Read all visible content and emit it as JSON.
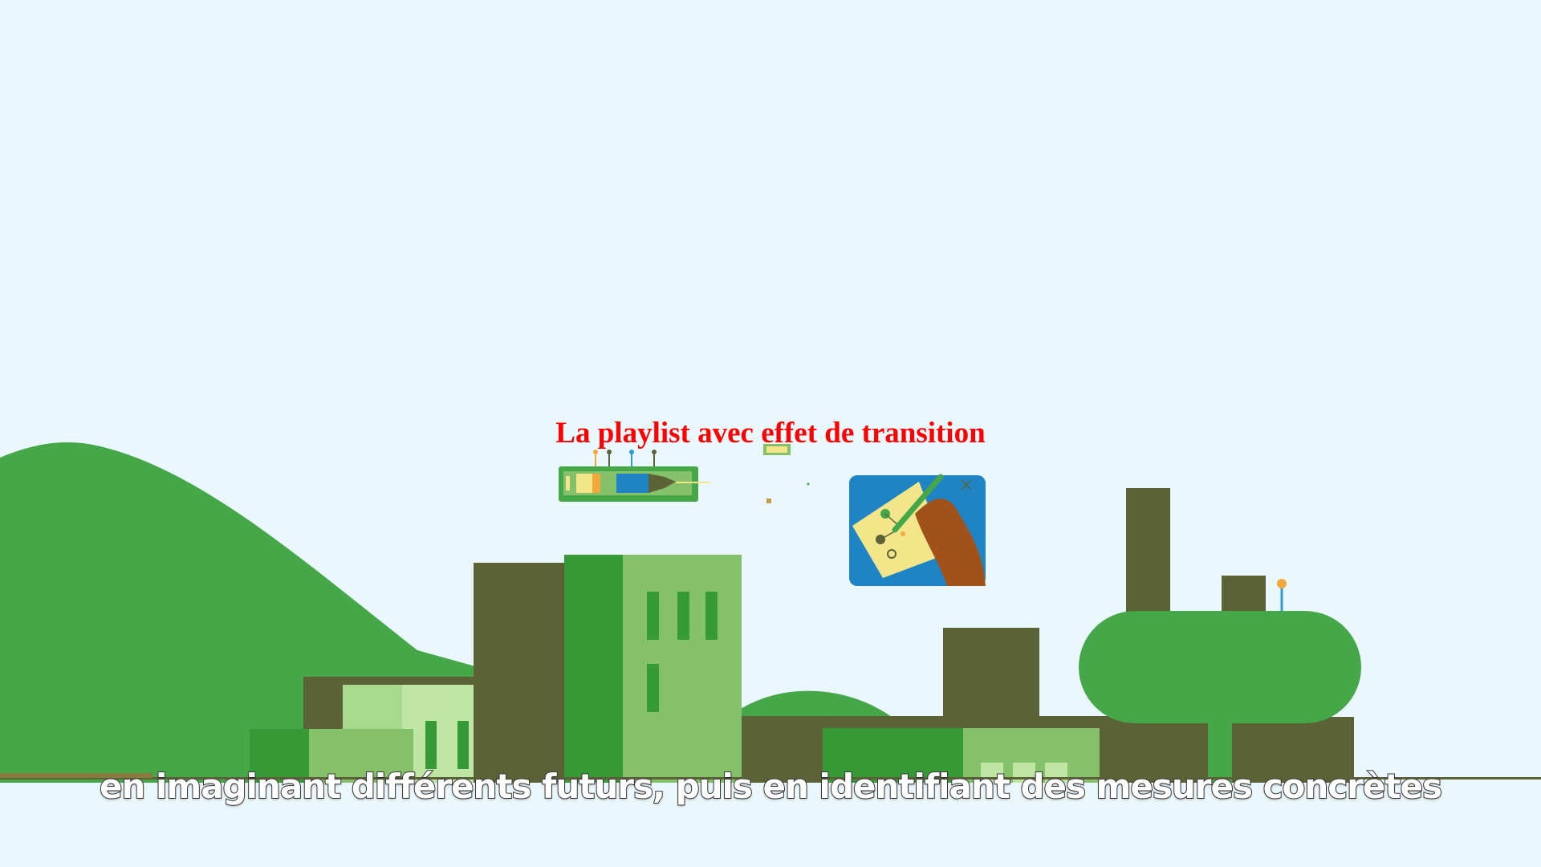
{
  "video": {
    "overlay_title": "La playlist avec effet de transition",
    "subtitle": "en imaginant différents futurs, puis en identifiant des mesures concrètes"
  },
  "illustration": {
    "elements": [
      "hill",
      "factory-buildings",
      "storage-tank",
      "chimney",
      "paintbrush-timeline-card",
      "hand-drawing-card"
    ],
    "colors": {
      "sky": "#eaf8fd",
      "hill_green": "#45a748",
      "dark_olive": "#5b6236",
      "mid_green": "#369b37",
      "light_green": "#85c06b",
      "pale_green": "#bfe6a4",
      "card_blue": "#1f84c4",
      "note_yellow": "#f3e68a",
      "hand_brown": "#a0521a",
      "pin_orange": "#f2a93b",
      "title_red": "#ff0000"
    }
  }
}
